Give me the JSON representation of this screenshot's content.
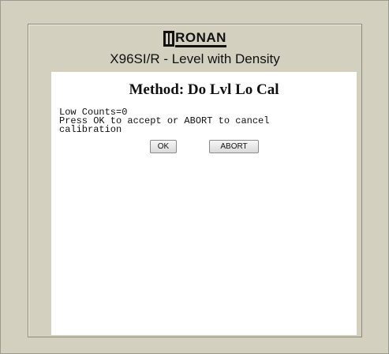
{
  "header": {
    "logo_text": "RONAN",
    "device_title": "X96SI/R - Level with Density"
  },
  "panel": {
    "method_title": "Method: Do Lvl Lo Cal",
    "message_lines": [
      "Low Counts=0",
      "Press OK to accept or ABORT to cancel",
      "calibration"
    ],
    "ok_label": "OK",
    "abort_label": "ABORT"
  },
  "colors": {
    "frame_background": "#d4d0c0",
    "panel_background": "#ffffff",
    "text": "#111111"
  }
}
